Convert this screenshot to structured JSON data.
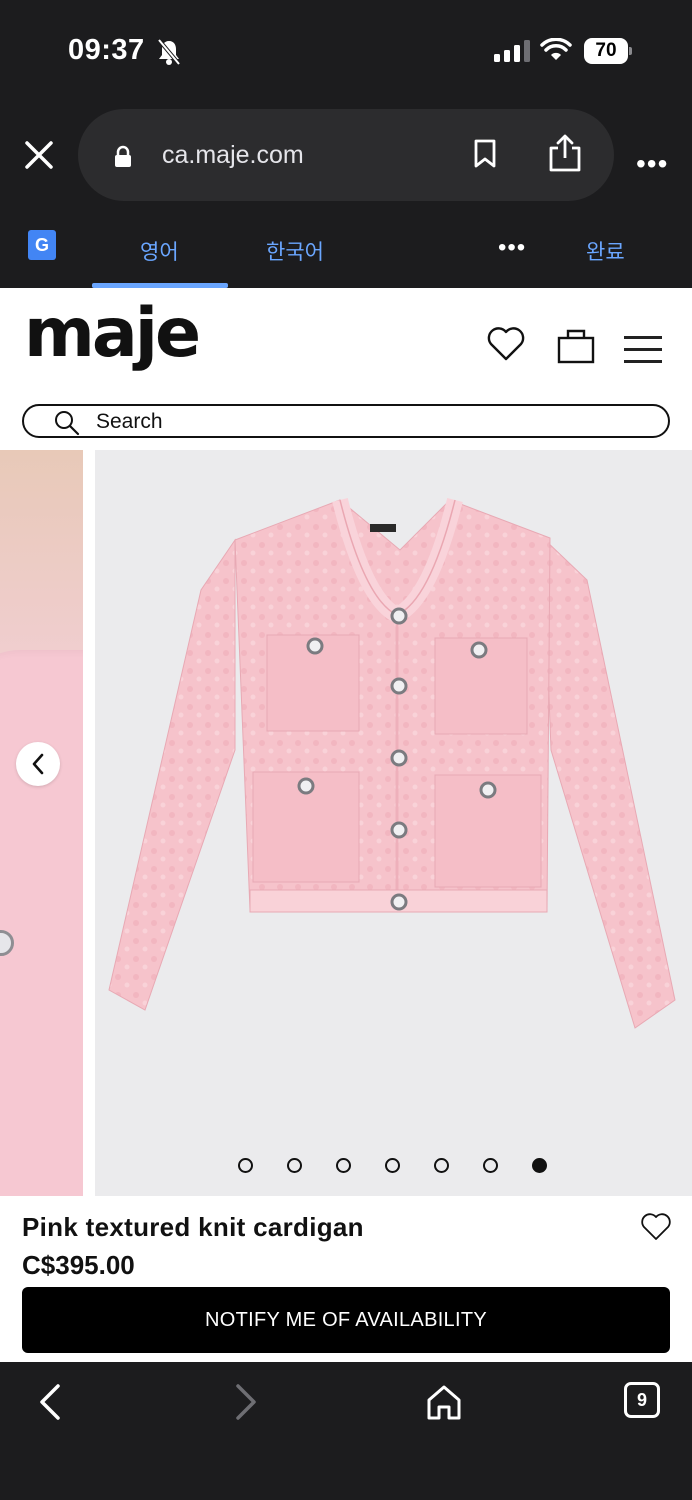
{
  "status": {
    "time": "09:37",
    "battery": "70",
    "signal_bars": 3,
    "wifi": true
  },
  "browser": {
    "url": "ca.maje.com",
    "tab_count": "9"
  },
  "translate": {
    "source_lang": "영어",
    "target_lang": "한국어",
    "more": "•••",
    "done": "완료"
  },
  "site": {
    "logo": "maje",
    "search_placeholder": "Search"
  },
  "product": {
    "name": "Pink textured knit cardigan",
    "price": "C$395.00",
    "cta": "NOTIFY ME OF AVAILABILITY",
    "image_count": 7,
    "active_image": 7,
    "color": "#f6c3cb"
  },
  "icons": {
    "close": "close-icon",
    "lock": "lock-icon",
    "bookmark": "bookmark-icon",
    "share": "share-icon",
    "heart": "heart-icon",
    "bag": "bag-icon",
    "menu": "hamburger-icon",
    "search": "search-icon",
    "back": "chevron-left-icon",
    "forward": "chevron-right-icon",
    "home": "home-icon"
  }
}
